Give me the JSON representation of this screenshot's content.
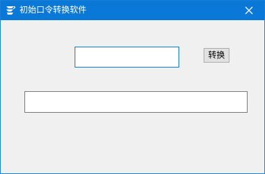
{
  "window": {
    "title": "初始口令转换软件",
    "app_icon": "app-logo-icon",
    "close_icon": "close-icon",
    "colors": {
      "titlebar": "#0a78d7",
      "client_background": "#f0f0f0",
      "focused_input_border": "#0a78d7"
    }
  },
  "form": {
    "top_input_value": "",
    "convert_button_label": "转换",
    "bottom_input_value": ""
  }
}
